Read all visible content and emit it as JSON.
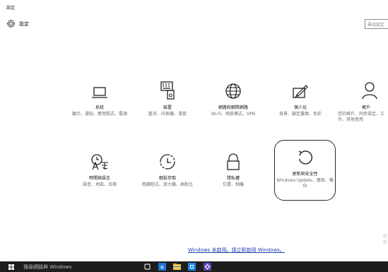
{
  "window": {
    "title": "設定"
  },
  "header": {
    "title": "設定",
    "icon": "gear-icon"
  },
  "search": {
    "placeholder": "尋找設定"
  },
  "tiles": [
    {
      "icon": "laptop-icon",
      "title": "系統",
      "desc": "顯示、通知、應用程式、電源"
    },
    {
      "icon": "keyboard-device-icon",
      "title": "裝置",
      "desc": "藍牙、印表機、滑鼠"
    },
    {
      "icon": "globe-icon",
      "title": "網路和網際網路",
      "desc": "Wi-Fi、飛航模式、VPN"
    },
    {
      "icon": "personalize-icon",
      "title": "個人化",
      "desc": "背景、鎖定畫面、色彩"
    },
    {
      "icon": "person-icon",
      "title": "帳戶",
      "desc": "您的帳戶、同步設定、工作、其他使用"
    },
    {
      "icon": "time-language-icon",
      "title": "時間與語言",
      "desc": "語音、地區、日期"
    },
    {
      "icon": "ease-of-access-icon",
      "title": "輕鬆存取",
      "desc": "朗讀程式、放大鏡、高對比"
    },
    {
      "icon": "lock-icon",
      "title": "隱私權",
      "desc": "位置、相機"
    },
    {
      "icon": "refresh-icon",
      "title": "更新與安全性",
      "desc": "Windows Update、復原、備份"
    }
  ],
  "side_faint": [
    "啟",
    "移"
  ],
  "activation": {
    "text": "Windows 未啟用。請立即啟用 Windows。"
  },
  "taskbar": {
    "search_text": "搜尋網路與 Windows"
  },
  "colors": {
    "accent": "#1f3fb5",
    "taskbar": "#1d1d1d"
  }
}
